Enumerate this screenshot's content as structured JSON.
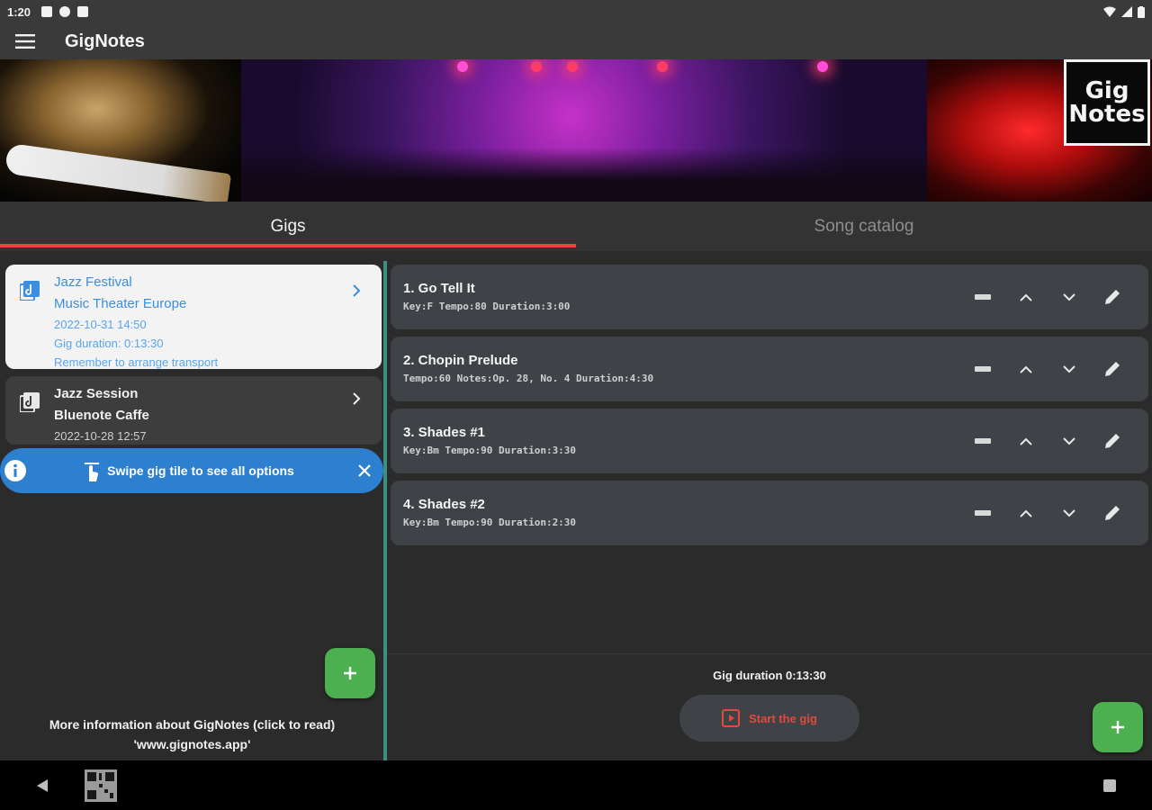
{
  "status_bar": {
    "time": "1:20"
  },
  "app_bar": {
    "title": "GigNotes",
    "menu_icon": "hamburger-menu-icon"
  },
  "banner": {
    "logo_line1": "Gig",
    "logo_line2": "Notes"
  },
  "tabs": [
    {
      "label": "Gigs",
      "active": true
    },
    {
      "label": "Song catalog",
      "active": false
    }
  ],
  "gigs": [
    {
      "title": "Jazz Festival",
      "venue": "Music Theater Europe",
      "datetime": "2022-10-31 14:50",
      "duration": "Gig duration: 0:13:30",
      "note": "Remember to arrange transport",
      "selected": true
    },
    {
      "title": "Jazz Session",
      "venue": "Bluenote Caffe",
      "datetime": "2022-10-28 12:57",
      "selected": false
    }
  ],
  "info_banner": {
    "text": "Swipe gig tile to see all options"
  },
  "more_info": {
    "line1": "More information about GigNotes (click to read)",
    "line2": "'www.gignotes.app'"
  },
  "songs": [
    {
      "title": "1. Go Tell It",
      "meta": "Key:F  Tempo:80  Duration:3:00"
    },
    {
      "title": "2. Chopin Prelude",
      "meta": "Tempo:60  Notes:Op. 28, No. 4  Duration:4:30"
    },
    {
      "title": "3.  Shades #1",
      "meta": "Key:Bm  Tempo:90  Duration:3:30"
    },
    {
      "title": "4. Shades #2",
      "meta": "Key:Bm  Tempo:90  Duration:2:30"
    }
  ],
  "gig_footer": {
    "total_duration": "Gig duration 0:13:30",
    "start_label": "Start the gig"
  },
  "colors": {
    "accent_red": "#e2483d",
    "fab_green": "#4caf50",
    "info_blue": "#2d7fd0",
    "selected_text_blue": "#3c8ee0",
    "divider_teal": "#3f8f80"
  }
}
